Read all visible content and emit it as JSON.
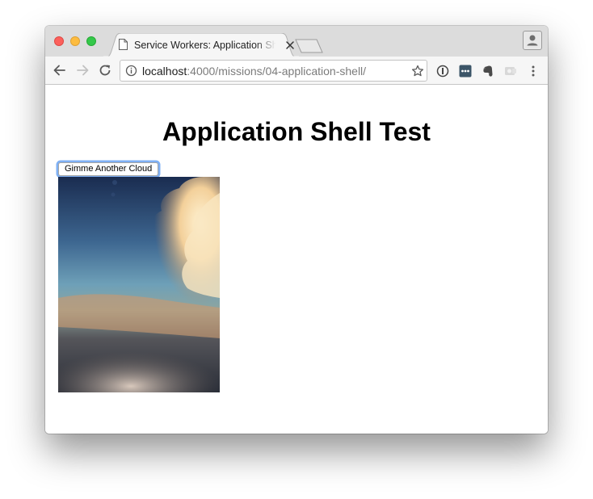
{
  "browser": {
    "tab_title": "Service Workers: Application Shell",
    "url_host": "localhost",
    "url_rest": ":4000/missions/04-application-shell/"
  },
  "page": {
    "heading": "Application Shell Test",
    "button_label": "Gimme Another Cloud"
  },
  "image": {
    "subject": "cloud photo at dusk viewed from an airplane window"
  },
  "icons": [
    "document-icon",
    "close-icon",
    "new-tab-icon",
    "profile-icon",
    "back-arrow-icon",
    "forward-arrow-icon",
    "reload-icon",
    "info-icon",
    "star-icon",
    "password-manager-icon",
    "evernote-icon",
    "extension-icon",
    "menu-dots-icon"
  ],
  "colors": {
    "focus_ring": "#7fb0f4",
    "tabstrip": "#dcdcdc",
    "toolbar": "#f6f6f6"
  }
}
